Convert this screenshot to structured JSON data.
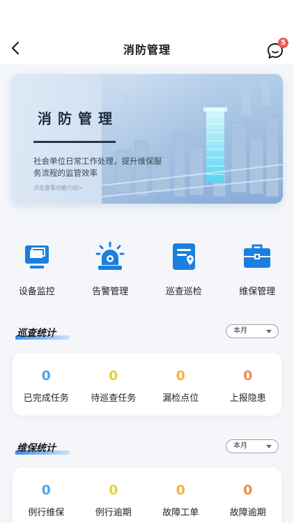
{
  "header": {
    "title": "消防管理",
    "back_icon": "chevron-left-icon",
    "message_icon": "chat-bubble-icon",
    "message_count": "5"
  },
  "banner": {
    "title": "消防管理",
    "description": "社会单位日常工作处理，提升维保服务流程的监管效率",
    "link_text": "点击查看功能介绍>"
  },
  "quick_actions": [
    {
      "label": "设备监控",
      "icon": "monitor-icon"
    },
    {
      "label": "告警管理",
      "icon": "alarm-light-icon"
    },
    {
      "label": "巡查巡检",
      "icon": "inspection-clipboard-icon"
    },
    {
      "label": "维保管理",
      "icon": "toolbox-icon"
    }
  ],
  "inspection_stats": {
    "title": "巡查统计",
    "period": "本月",
    "items": [
      {
        "value": "0",
        "label": "已完成任务",
        "color": "#4aa6ee"
      },
      {
        "value": "0",
        "label": "待巡查任务",
        "color": "#e6cf3a"
      },
      {
        "value": "0",
        "label": "漏检点位",
        "color": "#f0b446"
      },
      {
        "value": "0",
        "label": "上报隐患",
        "color": "#ef8a4a"
      }
    ]
  },
  "maintenance_stats": {
    "title": "维保统计",
    "period": "本月",
    "items": [
      {
        "value": "0",
        "label": "例行维保",
        "color": "#4aa6ee"
      },
      {
        "value": "0",
        "label": "例行逾期",
        "color": "#e6cf3a"
      },
      {
        "value": "0",
        "label": "故障工单",
        "color": "#f0b446"
      },
      {
        "value": "0",
        "label": "故障逾期",
        "color": "#ef8a4a"
      }
    ]
  },
  "colors": {
    "accent": "#1a7fe0",
    "background": "#f4f6fa"
  }
}
